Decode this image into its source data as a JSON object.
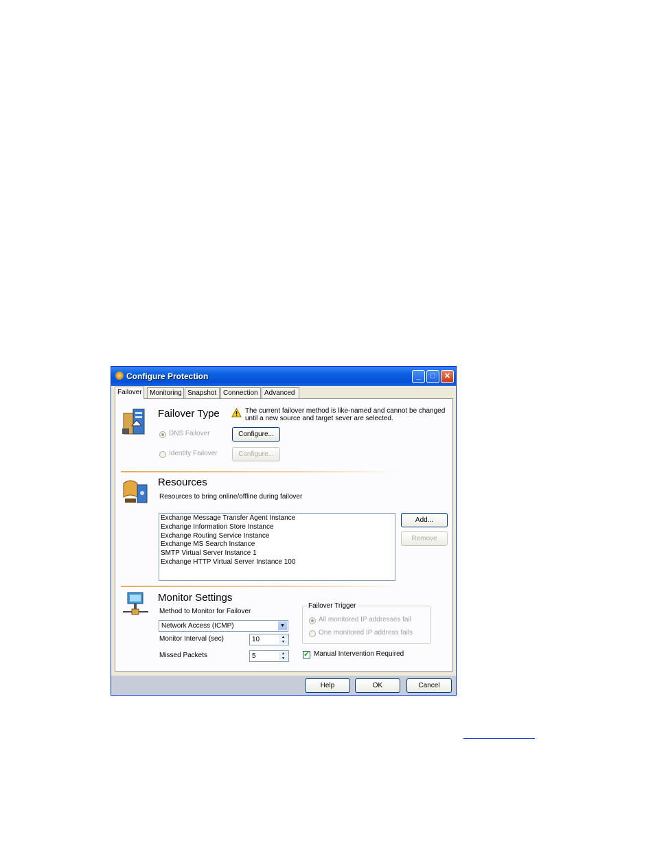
{
  "window": {
    "title": "Configure Protection"
  },
  "tabs": [
    {
      "label": "Failover"
    },
    {
      "label": "Monitoring"
    },
    {
      "label": "Snapshot"
    },
    {
      "label": "Connection"
    },
    {
      "label": "Advanced"
    }
  ],
  "failover_type": {
    "title": "Failover Type",
    "warning_line1": "The current failover method is like-named and cannot be changed",
    "warning_line2": "until a new source and target sever are selected.",
    "dns_label": "DNS Failover",
    "identity_label": "Identity Failover",
    "configure_button": "Configure...",
    "configure_button_disabled": "Configure..."
  },
  "resources": {
    "title": "Resources",
    "subtitle": "Resources to bring online/offline during failover",
    "items": [
      "Exchange Message Transfer Agent Instance",
      "Exchange Information Store Instance",
      "Exchange Routing Service Instance",
      "Exchange MS Search Instance",
      "SMTP Virtual Server Instance 1",
      "Exchange HTTP Virtual Server Instance 100"
    ],
    "add_button": "Add...",
    "remove_button": "Remove"
  },
  "monitor": {
    "title": "Monitor Settings",
    "method_label": "Method to Monitor for Failover",
    "method_value": "Network Access (ICMP)",
    "interval_label": "Monitor Interval (sec)",
    "interval_value": "10",
    "missed_label": "Missed Packets",
    "missed_value": "5",
    "trigger_label": "Failover Trigger",
    "trigger_all": "All monitored IP addresses fail",
    "trigger_one": "One monitored IP address fails",
    "manual_label": "Manual Intervention Required"
  },
  "footer": {
    "help": "Help",
    "ok": "OK",
    "cancel": "Cancel"
  },
  "colors": {
    "titlebar": "#0a5fe0",
    "panel": "#fcfcfe",
    "divider": "#e7a95c"
  }
}
